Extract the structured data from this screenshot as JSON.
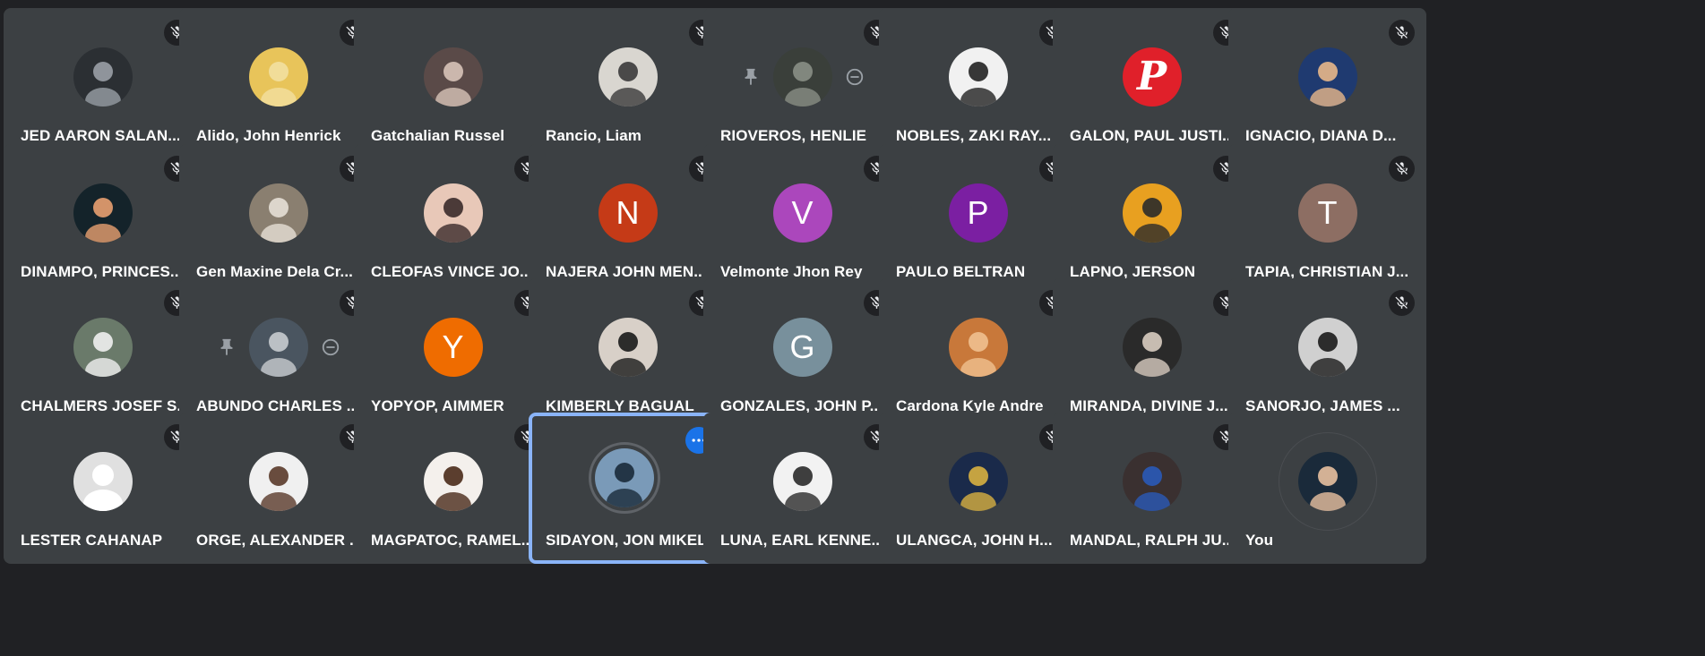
{
  "colors": {
    "background": "#202124",
    "tile": "#3c4043",
    "active_border": "#8ab4f8",
    "menu_button": "#1a73e8"
  },
  "participants": [
    {
      "name": "JED AARON SALAN...",
      "avatar": {
        "type": "photo",
        "bg": "#2b2f33",
        "fg": "#9aa0a6"
      },
      "muted": true
    },
    {
      "name": "Alido, John Henrick",
      "avatar": {
        "type": "photo",
        "bg": "#e8c45a",
        "fg": "#f2e0a0"
      },
      "muted": true
    },
    {
      "name": "Gatchalian Russel",
      "avatar": {
        "type": "photo",
        "bg": "#5a4a48",
        "fg": "#d7c3b8"
      },
      "muted": false
    },
    {
      "name": "Rancio, Liam",
      "avatar": {
        "type": "photo",
        "bg": "#d9d6d0",
        "fg": "#3a3a3a"
      },
      "muted": true
    },
    {
      "name": "RIOVEROS, HENLIE",
      "avatar": {
        "type": "photo",
        "bg": "#3a3f3a",
        "fg": "#8a8f86"
      },
      "muted": true,
      "pinned": true,
      "removable": true
    },
    {
      "name": "NOBLES, ZAKI RAY...",
      "avatar": {
        "type": "photo",
        "bg": "#f1f1f1",
        "fg": "#222222"
      },
      "muted": true
    },
    {
      "name": "GALON, PAUL JUSTI...",
      "avatar": {
        "type": "logo",
        "bg": "#e0202a",
        "letter": "P"
      },
      "muted": true
    },
    {
      "name": "IGNACIO, DIANA D...",
      "avatar": {
        "type": "photo",
        "bg": "#1f3a70",
        "fg": "#e8b88a"
      },
      "muted": true
    },
    {
      "name": "DINAMPO, PRINCES...",
      "avatar": {
        "type": "photo",
        "bg": "#14232a",
        "fg": "#e8a070"
      },
      "muted": true
    },
    {
      "name": "Gen Maxine Dela Cr...",
      "avatar": {
        "type": "photo",
        "bg": "#8a7f70",
        "fg": "#e6e0d6"
      },
      "muted": true
    },
    {
      "name": "CLEOFAS VINCE JO...",
      "avatar": {
        "type": "photo",
        "bg": "#e8c8b8",
        "fg": "#3a2a2a"
      },
      "muted": true
    },
    {
      "name": "NAJERA JOHN MEN...",
      "avatar": {
        "type": "letter",
        "bg": "#c53a17",
        "letter": "N"
      },
      "muted": true
    },
    {
      "name": "Velmonte Jhon Rey",
      "avatar": {
        "type": "letter",
        "bg": "#ab47bc",
        "letter": "V"
      },
      "muted": true
    },
    {
      "name": "PAULO BELTRAN",
      "avatar": {
        "type": "letter",
        "bg": "#7b1fa2",
        "letter": "P"
      },
      "muted": true
    },
    {
      "name": "LAPNO, JERSON",
      "avatar": {
        "type": "photo",
        "bg": "#e8a020",
        "fg": "#2a2a2a"
      },
      "muted": true
    },
    {
      "name": "TAPIA, CHRISTIAN J...",
      "avatar": {
        "type": "letter",
        "bg": "#8d6e63",
        "letter": "T"
      },
      "muted": true
    },
    {
      "name": "CHALMERS JOSEF S...",
      "avatar": {
        "type": "photo",
        "bg": "#6a7a6a",
        "fg": "#f0f0f0"
      },
      "muted": true
    },
    {
      "name": "ABUNDO CHARLES ...",
      "avatar": {
        "type": "photo",
        "bg": "#4a5560",
        "fg": "#c8ccd0"
      },
      "muted": true,
      "pinned": true,
      "removable": true
    },
    {
      "name": "YOPYOP, AIMMER",
      "avatar": {
        "type": "letter",
        "bg": "#ef6c00",
        "letter": "Y"
      },
      "muted": true
    },
    {
      "name": "KIMBERLY BAGUAL",
      "avatar": {
        "type": "photo",
        "bg": "#d8d0c8",
        "fg": "#1a1a1a"
      },
      "muted": true
    },
    {
      "name": "GONZALES, JOHN P...",
      "avatar": {
        "type": "letter",
        "bg": "#78909c",
        "letter": "G"
      },
      "muted": true
    },
    {
      "name": "Cardona Kyle Andre",
      "avatar": {
        "type": "photo",
        "bg": "#c8783a",
        "fg": "#f0c090"
      },
      "muted": true
    },
    {
      "name": "MIRANDA, DIVINE J...",
      "avatar": {
        "type": "photo",
        "bg": "#2a2a2a",
        "fg": "#d8ccc0"
      },
      "muted": true
    },
    {
      "name": "SANORJO, JAMES ...",
      "avatar": {
        "type": "photo",
        "bg": "#d0d0d0",
        "fg": "#1a1a1a"
      },
      "muted": true
    },
    {
      "name": "LESTER CAHANAP",
      "avatar": {
        "type": "default",
        "bg": "#e0e0e0",
        "fg": "#bdbdbd"
      },
      "muted": true
    },
    {
      "name": "ORGE, ALEXANDER ...",
      "avatar": {
        "type": "photo",
        "bg": "#f0f0f0",
        "fg": "#5a3a2a"
      },
      "muted": true
    },
    {
      "name": "MAGPATOC, RAMEL...",
      "avatar": {
        "type": "photo",
        "bg": "#f4f0ec",
        "fg": "#4a2a1a"
      },
      "muted": true
    },
    {
      "name": "SIDAYON, JON MIKEL",
      "avatar": {
        "type": "photo",
        "bg": "#7a9ab8",
        "fg": "#1a2a3a"
      },
      "muted": false,
      "active": true,
      "menu": true
    },
    {
      "name": "LUNA, EARL KENNE...",
      "avatar": {
        "type": "photo",
        "bg": "#f2f2f2",
        "fg": "#2a2a2a"
      },
      "muted": true
    },
    {
      "name": "ULANGCA, JOHN H...",
      "avatar": {
        "type": "photo",
        "bg": "#1a2a4a",
        "fg": "#d8b040"
      },
      "muted": true
    },
    {
      "name": "MANDAL, RALPH JU...",
      "avatar": {
        "type": "photo",
        "bg": "#3a3030",
        "fg": "#2a5ab8"
      },
      "muted": true
    },
    {
      "name": "You",
      "avatar": {
        "type": "photo",
        "bg": "#1a2a3a",
        "fg": "#e8c0a0"
      },
      "muted": false,
      "self": true
    }
  ]
}
